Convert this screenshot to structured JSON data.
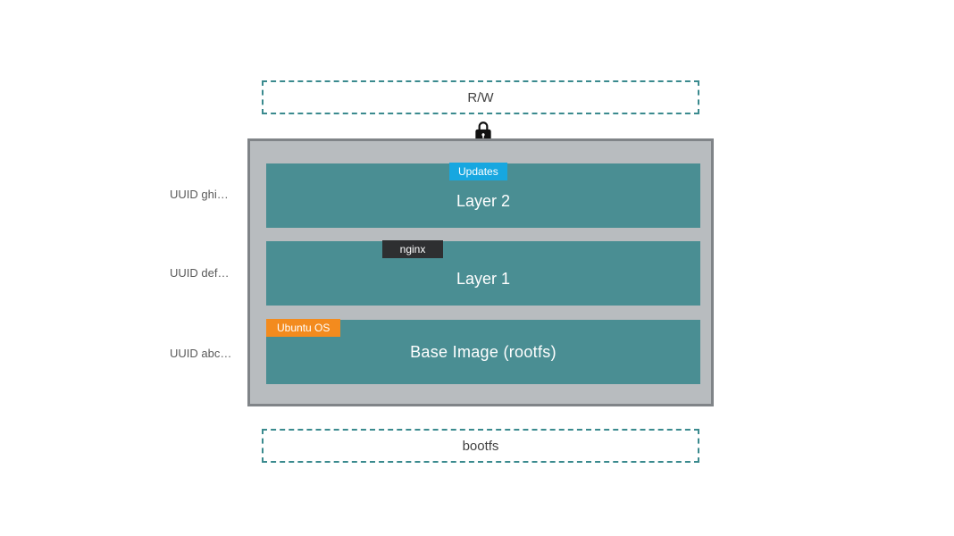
{
  "top_box": {
    "label": "R/W"
  },
  "bottom_box": {
    "label": "bootfs"
  },
  "uuids": {
    "ghi": "UUID ghi…",
    "def": "UUID def…",
    "abc": "UUID abc…"
  },
  "layers": {
    "layer2": {
      "title": "Layer 2",
      "tag": "Updates"
    },
    "layer1": {
      "title": "Layer 1",
      "tag": "nginx"
    },
    "base": {
      "title": "Base Image   (rootfs)",
      "tag": "Ubuntu OS"
    }
  },
  "icons": {
    "lock": "lock-icon"
  }
}
